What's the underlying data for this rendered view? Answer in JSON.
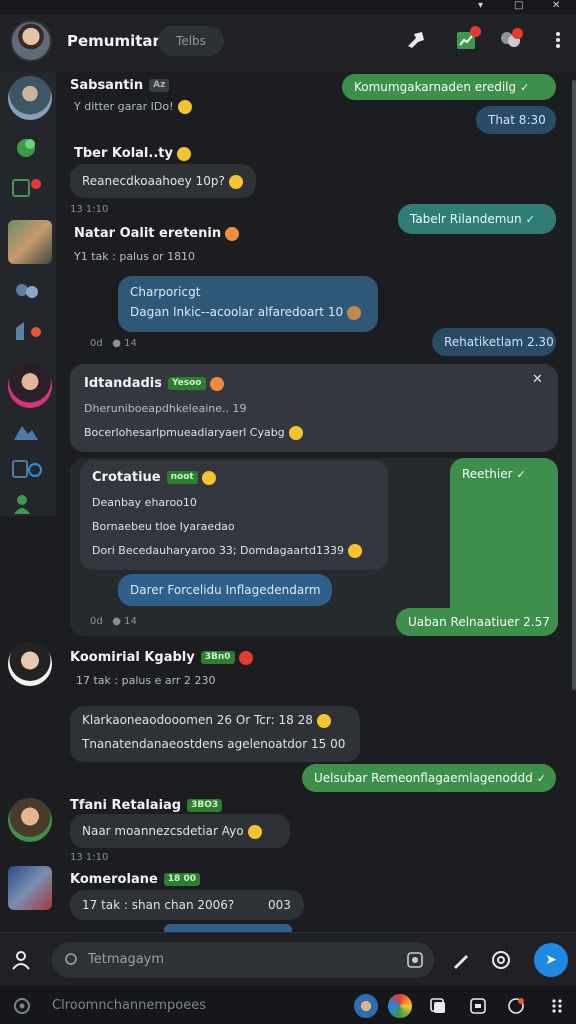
{
  "header": {
    "title": "Pemumitan",
    "tab": "Telbs"
  },
  "messages": {
    "m1_name": "Sabsantin",
    "m1_sub": "Y ditter garar IDo!",
    "m1_out": "Komumgakarnaden eredilg",
    "m1_out2": "That 8:30",
    "m2_name": "Tber Kolal..ty",
    "m2_bubble": "Reanecdkoaahoey 10p?",
    "m2_time": "13 1:10",
    "m2_out": "Tabelr Rilandemun",
    "m3_name": "Natar Oalit eretenin",
    "m3_sub": "Y1 tak : palus or 1810",
    "m3_b1": "Charporicgt",
    "m3_b2": "Dagan Inkic--acoolar alfaredoart 10",
    "m3_meta": "0d",
    "m3_meta2": "14",
    "m3_out": "Rehatiketlam 2.30",
    "m4_name": "Idtandadis",
    "m4_tag": "Yesoo",
    "m4_l1": "Dheruniboeapdhkeleaine.. 19",
    "m4_l2": "Bocerlohesarlpmueadiaryaerl Cyabg",
    "m5_name": "Crotatiue",
    "m5_tag": "noot",
    "m5_l1": "Deanbay eharoo10",
    "m5_l2": "Bornaebeu tloe Iyaraedao",
    "m5_l3": "Dori Becedauharyaroo 33; Domdagaartd1339",
    "m5_out": "Reethier",
    "m5_blue": "Darer Forcelidu Inflagedendarm",
    "m5_meta": "0d",
    "m5_meta2": "14",
    "m5_out2": "Uaban Relnaatiuer 2.57",
    "m6_name": "Koomirial Kgably",
    "m6_tag": "3Bn0",
    "m6_sub": "17 tak : palus e arr 2 230",
    "m6_l1": "Klarkaoneaodooomen 26 Or Tcr: 18 28",
    "m6_l2": "Tnanatendanaeostdens agelenoatdor 15 00",
    "m6_out": "Uelsubar Remeonflagaemlagenoddd",
    "m7_name": "Tfani Retalaiag",
    "m7_tag": "3BO3",
    "m7_bubble": "Naar moannezcsdetiar Ayo",
    "m7_time": "13 1:10",
    "m8_name": "Komerolane",
    "m8_tag": "18 00",
    "m8_sub": "17 tak : shan chan 2006?",
    "m8_sub2": "003"
  },
  "composer": {
    "placeholder": "Tetmagaym"
  },
  "footer": {
    "text": "Clroomnchannempoees"
  },
  "colors": {
    "accent_green": "#3f8f4c",
    "accent_teal": "#2f7d74",
    "send_blue": "#1e88e5"
  }
}
